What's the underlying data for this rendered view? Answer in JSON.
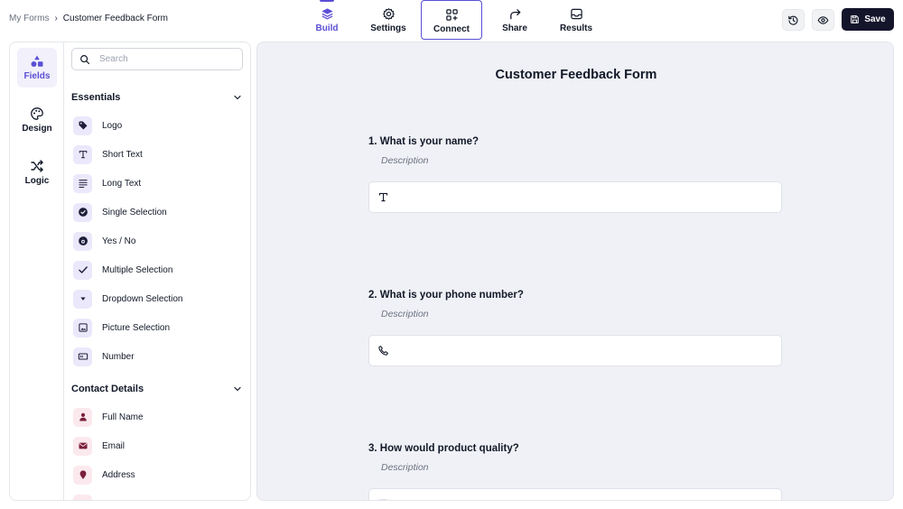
{
  "breadcrumb": {
    "parent": "My Forms",
    "separator": "›",
    "current": "Customer Feedback Form"
  },
  "nav": {
    "tabs": [
      {
        "label": "Build",
        "icon": "layers-icon",
        "active": true
      },
      {
        "label": "Settings",
        "icon": "gear-icon"
      },
      {
        "label": "Connect",
        "icon": "apps-add-icon",
        "highlighted": true
      },
      {
        "label": "Share",
        "icon": "share-arrow-icon"
      },
      {
        "label": "Results",
        "icon": "inbox-icon"
      }
    ]
  },
  "toolbar": {
    "history_icon": "history-icon",
    "preview_icon": "eye-icon",
    "save_label": "Save"
  },
  "rail": {
    "items": [
      {
        "label": "Fields",
        "icon": "shapes-icon",
        "active": true
      },
      {
        "label": "Design",
        "icon": "palette-icon"
      },
      {
        "label": "Logic",
        "icon": "shuffle-icon"
      }
    ]
  },
  "search": {
    "placeholder": "Search",
    "value": ""
  },
  "sections": [
    {
      "title": "Essentials",
      "items": [
        {
          "label": "Logo",
          "icon": "tag-icon"
        },
        {
          "label": "Short Text",
          "icon": "text-t-icon"
        },
        {
          "label": "Long Text",
          "icon": "paragraph-icon"
        },
        {
          "label": "Single Selection",
          "icon": "check-circle-icon"
        },
        {
          "label": "Yes / No",
          "icon": "yes-no-icon"
        },
        {
          "label": "Multiple Selection",
          "icon": "check-icon"
        },
        {
          "label": "Dropdown Selection",
          "icon": "dropdown-icon"
        },
        {
          "label": "Picture Selection",
          "icon": "picture-icon"
        },
        {
          "label": "Number",
          "icon": "number-icon"
        }
      ]
    },
    {
      "title": "Contact Details",
      "items": [
        {
          "label": "Full Name",
          "icon": "person-icon"
        },
        {
          "label": "Email",
          "icon": "envelope-icon"
        },
        {
          "label": "Address",
          "icon": "map-pin-icon"
        }
      ]
    }
  ],
  "form": {
    "title": "Customer Feedback Form",
    "questions": [
      {
        "number": "1.",
        "text": "What is your name?",
        "description": "Description",
        "input_icon": "text-t-icon"
      },
      {
        "number": "2.",
        "text": "What is your phone number?",
        "description": "Description",
        "input_icon": "phone-icon"
      },
      {
        "number": "3.",
        "text": "How would product quality?",
        "description": "Description",
        "input_icon": "text-t-icon"
      }
    ]
  },
  "colors": {
    "accent": "#5b4fd6",
    "save_bg": "#14142b",
    "canvas_bg": "#f0f1f6",
    "contact_icon": "#7a1f3d"
  }
}
